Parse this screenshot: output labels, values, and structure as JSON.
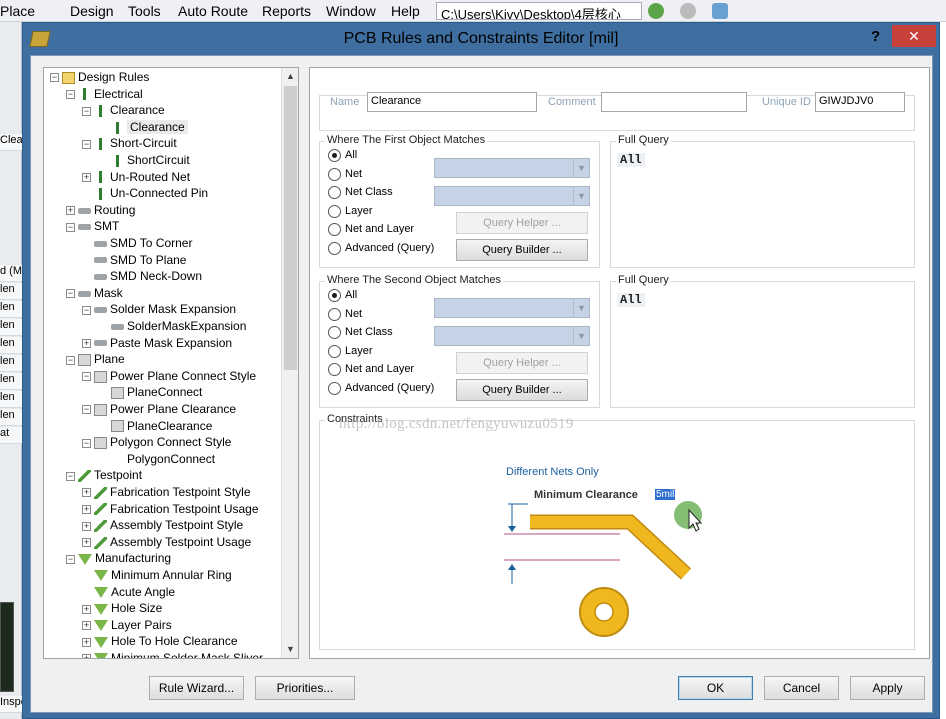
{
  "menu": {
    "items": [
      "Place",
      "Design",
      "Tools",
      "Auto Route",
      "Reports",
      "Window",
      "Help"
    ],
    "path": "C:\\Users\\Kivy\\Desktop\\4层核心"
  },
  "left_strip": {
    "items": [
      "Clear",
      "d (Ma",
      "len",
      "len",
      "len",
      "len",
      "len",
      "len",
      "len",
      "len",
      "at"
    ],
    "bottom_label": "Inspe"
  },
  "dialog": {
    "title": "PCB Rules and Constraints Editor [mil]",
    "help_label": "?",
    "close_label": "✕",
    "tree": [
      {
        "label": "Design Rules",
        "level": 0,
        "exp": "−",
        "icon": "folder"
      },
      {
        "label": "Electrical",
        "level": 1,
        "exp": "−",
        "icon": "elec"
      },
      {
        "label": "Clearance",
        "level": 2,
        "exp": "−",
        "icon": "elec"
      },
      {
        "label": "Clearance",
        "level": 3,
        "exp": "",
        "icon": "elec",
        "selected": true
      },
      {
        "label": "Short-Circuit",
        "level": 2,
        "exp": "−",
        "icon": "elec"
      },
      {
        "label": "ShortCircuit",
        "level": 3,
        "exp": "",
        "icon": "elec"
      },
      {
        "label": "Un-Routed Net",
        "level": 2,
        "exp": "+",
        "icon": "elec"
      },
      {
        "label": "Un-Connected Pin",
        "level": 2,
        "exp": "",
        "icon": "elec"
      },
      {
        "label": "Routing",
        "level": 1,
        "exp": "+",
        "icon": "grey"
      },
      {
        "label": "SMT",
        "level": 1,
        "exp": "−",
        "icon": "grey"
      },
      {
        "label": "SMD To Corner",
        "level": 2,
        "exp": "",
        "icon": "grey"
      },
      {
        "label": "SMD To Plane",
        "level": 2,
        "exp": "",
        "icon": "grey"
      },
      {
        "label": "SMD Neck-Down",
        "level": 2,
        "exp": "",
        "icon": "grey"
      },
      {
        "label": "Mask",
        "level": 1,
        "exp": "−",
        "icon": "grey"
      },
      {
        "label": "Solder Mask Expansion",
        "level": 2,
        "exp": "−",
        "icon": "grey"
      },
      {
        "label": "SolderMaskExpansion",
        "level": 3,
        "exp": "",
        "icon": "grey"
      },
      {
        "label": "Paste Mask Expansion",
        "level": 2,
        "exp": "+",
        "icon": "grey"
      },
      {
        "label": "Plane",
        "level": 1,
        "exp": "−",
        "icon": "plane"
      },
      {
        "label": "Power Plane Connect Style",
        "level": 2,
        "exp": "−",
        "icon": "plane"
      },
      {
        "label": "PlaneConnect",
        "level": 3,
        "exp": "",
        "icon": "plane"
      },
      {
        "label": "Power Plane Clearance",
        "level": 2,
        "exp": "−",
        "icon": "plane"
      },
      {
        "label": "PlaneClearance",
        "level": 3,
        "exp": "",
        "icon": "plane"
      },
      {
        "label": "Polygon Connect Style",
        "level": 2,
        "exp": "−",
        "icon": "plane"
      },
      {
        "label": "PolygonConnect",
        "level": 3,
        "exp": "",
        "icon": "none"
      },
      {
        "label": "Testpoint",
        "level": 1,
        "exp": "−",
        "icon": "tp"
      },
      {
        "label": "Fabrication Testpoint Style",
        "level": 2,
        "exp": "+",
        "icon": "tp"
      },
      {
        "label": "Fabrication Testpoint Usage",
        "level": 2,
        "exp": "+",
        "icon": "tp"
      },
      {
        "label": "Assembly Testpoint Style",
        "level": 2,
        "exp": "+",
        "icon": "tp"
      },
      {
        "label": "Assembly Testpoint Usage",
        "level": 2,
        "exp": "+",
        "icon": "tp"
      },
      {
        "label": "Manufacturing",
        "level": 1,
        "exp": "−",
        "icon": "mfg"
      },
      {
        "label": "Minimum Annular Ring",
        "level": 2,
        "exp": "",
        "icon": "mfg"
      },
      {
        "label": "Acute Angle",
        "level": 2,
        "exp": "",
        "icon": "mfg"
      },
      {
        "label": "Hole Size",
        "level": 2,
        "exp": "+",
        "icon": "mfg"
      },
      {
        "label": "Layer Pairs",
        "level": 2,
        "exp": "+",
        "icon": "mfg"
      },
      {
        "label": "Hole To Hole Clearance",
        "level": 2,
        "exp": "+",
        "icon": "mfg"
      },
      {
        "label": "Minimum Solder Mask Sliver",
        "level": 2,
        "exp": "+",
        "icon": "mfg"
      }
    ],
    "fields": {
      "name_label": "Name",
      "name_value": "Clearance",
      "comment_label": "Comment",
      "comment_value": "",
      "uid_label": "Unique ID",
      "uid_value": "GIWJDJV0"
    },
    "first": {
      "title": "Where The First Object Matches",
      "options": [
        "All",
        "Net",
        "Net Class",
        "Layer",
        "Net and Layer",
        "Advanced (Query)"
      ],
      "selected": "All",
      "query_helper": "Query Helper ...",
      "query_builder": "Query Builder ...",
      "full_query_label": "Full Query",
      "full_query_text": "All"
    },
    "second": {
      "title": "Where The Second Object Matches",
      "options": [
        "All",
        "Net",
        "Net Class",
        "Layer",
        "Net and Layer",
        "Advanced (Query)"
      ],
      "selected": "All",
      "query_helper": "Query Helper ...",
      "query_builder": "Query Builder ...",
      "full_query_label": "Full Query",
      "full_query_text": "All"
    },
    "watermark": "http://blog.csdn.net/fengyuwuzu0519",
    "constraints": {
      "title": "Constraints",
      "scope_label": "Different Nets Only",
      "min_clearance_label": "Minimum Clearance",
      "min_clearance_value": "5mil"
    },
    "buttons": {
      "rule_wizard": "Rule Wizard...",
      "priorities": "Priorities...",
      "ok": "OK",
      "cancel": "Cancel",
      "apply": "Apply"
    }
  },
  "colors": {
    "titlebar": "#3f6fa1",
    "close": "#c7403a",
    "copper": "#f0b81e",
    "copper_edge": "#c08a12",
    "accent_blue": "#1a5f9e"
  }
}
